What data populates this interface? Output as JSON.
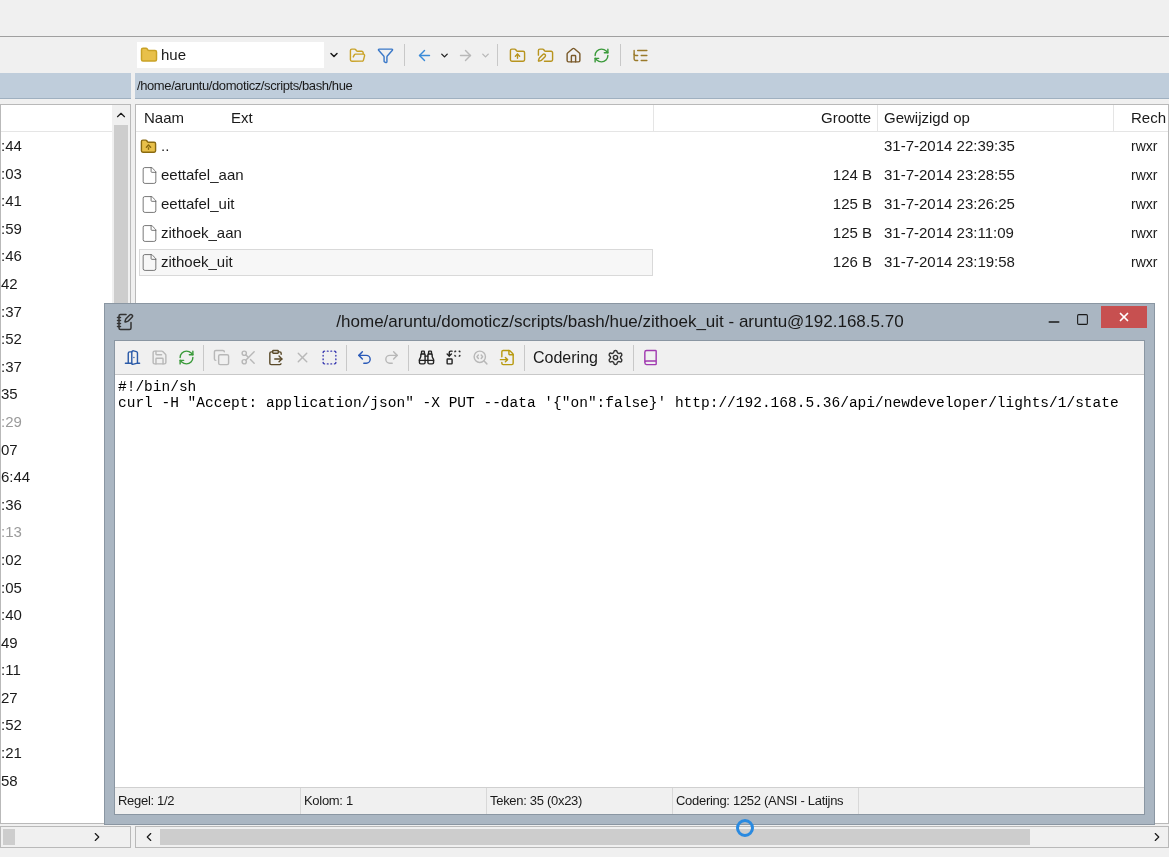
{
  "toolbar": {
    "location": "hue",
    "buttons": [
      {
        "kind": "open",
        "disabled": false
      },
      {
        "kind": "filter",
        "disabled": false
      },
      {
        "kind": "back",
        "disabled": false
      },
      {
        "kind": "forward",
        "disabled": true
      },
      {
        "kind": "parent",
        "disabled": false
      },
      {
        "kind": "root",
        "disabled": false
      },
      {
        "kind": "home",
        "disabled": false
      },
      {
        "kind": "refresh",
        "disabled": false
      },
      {
        "kind": "tree",
        "disabled": false
      }
    ]
  },
  "left_panel": {
    "rows": [
      {
        "text": ":44",
        "dimmed": false
      },
      {
        "text": ":03",
        "dimmed": false
      },
      {
        "text": ":41",
        "dimmed": false
      },
      {
        "text": ":59",
        "dimmed": false
      },
      {
        "text": ":46",
        "dimmed": false
      },
      {
        "text": "42",
        "dimmed": false
      },
      {
        "text": ":37",
        "dimmed": false
      },
      {
        "text": ":52",
        "dimmed": false
      },
      {
        "text": ":37",
        "dimmed": false
      },
      {
        "text": "35",
        "dimmed": false
      },
      {
        "text": ":29",
        "dimmed": true
      },
      {
        "text": "07",
        "dimmed": false
      },
      {
        "text": "6:44",
        "dimmed": false
      },
      {
        "text": ":36",
        "dimmed": false
      },
      {
        "text": ":13",
        "dimmed": true
      },
      {
        "text": ":02",
        "dimmed": false
      },
      {
        "text": ":05",
        "dimmed": false
      },
      {
        "text": ":40",
        "dimmed": false
      },
      {
        "text": "49",
        "dimmed": false
      },
      {
        "text": ":11",
        "dimmed": false
      },
      {
        "text": "27",
        "dimmed": false
      },
      {
        "text": ":52",
        "dimmed": false
      },
      {
        "text": ":21",
        "dimmed": false
      },
      {
        "text": "58",
        "dimmed": false
      }
    ]
  },
  "right_panel": {
    "path": "/home/aruntu/domoticz/scripts/bash/hue",
    "columns": [
      "Naam",
      "Ext",
      "Grootte",
      "Gewijzigd op",
      "Rech"
    ],
    "rows": [
      {
        "kind": "parent",
        "name": "..",
        "size": "",
        "modified": "31-7-2014 22:39:35",
        "rights": "rwxr",
        "selected": false
      },
      {
        "kind": "file",
        "name": "eettafel_aan",
        "size": "124 B",
        "modified": "31-7-2014 23:28:55",
        "rights": "rwxr",
        "selected": false
      },
      {
        "kind": "file",
        "name": "eettafel_uit",
        "size": "125 B",
        "modified": "31-7-2014 23:26:25",
        "rights": "rwxr",
        "selected": false
      },
      {
        "kind": "file",
        "name": "zithoek_aan",
        "size": "125 B",
        "modified": "31-7-2014 23:11:09",
        "rights": "rwxr",
        "selected": false
      },
      {
        "kind": "file",
        "name": "zithoek_uit",
        "size": "126 B",
        "modified": "31-7-2014 23:19:58",
        "rights": "rwxr",
        "selected": true
      }
    ]
  },
  "editor": {
    "title": "/home/aruntu/domoticz/scripts/bash/hue/zithoek_uit - aruntu@192.168.5.70",
    "toolbar": [
      {
        "kind": "exit",
        "disabled": false
      },
      {
        "kind": "save",
        "disabled": true
      },
      {
        "kind": "reload",
        "disabled": false
      },
      {
        "kind": "sep"
      },
      {
        "kind": "copy",
        "disabled": true
      },
      {
        "kind": "cut",
        "disabled": true
      },
      {
        "kind": "paste",
        "disabled": false
      },
      {
        "kind": "delete",
        "disabled": true
      },
      {
        "kind": "selectall",
        "disabled": false
      },
      {
        "kind": "sep"
      },
      {
        "kind": "undo",
        "disabled": false
      },
      {
        "kind": "redo",
        "disabled": true
      },
      {
        "kind": "sep"
      },
      {
        "kind": "find",
        "disabled": false
      },
      {
        "kind": "replace",
        "disabled": false
      },
      {
        "kind": "findnext",
        "disabled": true
      },
      {
        "kind": "goto",
        "disabled": false
      },
      {
        "kind": "sep"
      },
      {
        "kind": "encoding",
        "label": "Codering",
        "disabled": false
      },
      {
        "kind": "settings",
        "disabled": false
      },
      {
        "kind": "sep"
      },
      {
        "kind": "help",
        "disabled": false
      }
    ],
    "lines": [
      "#!/bin/sh",
      "curl -H \"Accept: application/json\" -X PUT --data '{\"on\":false}' http://192.168.5.36/api/newdeveloper/lights/1/state"
    ],
    "status": [
      "Regel: 1/2",
      "Kolom: 1",
      "Teken: 35 (0x23)",
      "Codering: 1252  (ANSI - Latijns"
    ]
  }
}
